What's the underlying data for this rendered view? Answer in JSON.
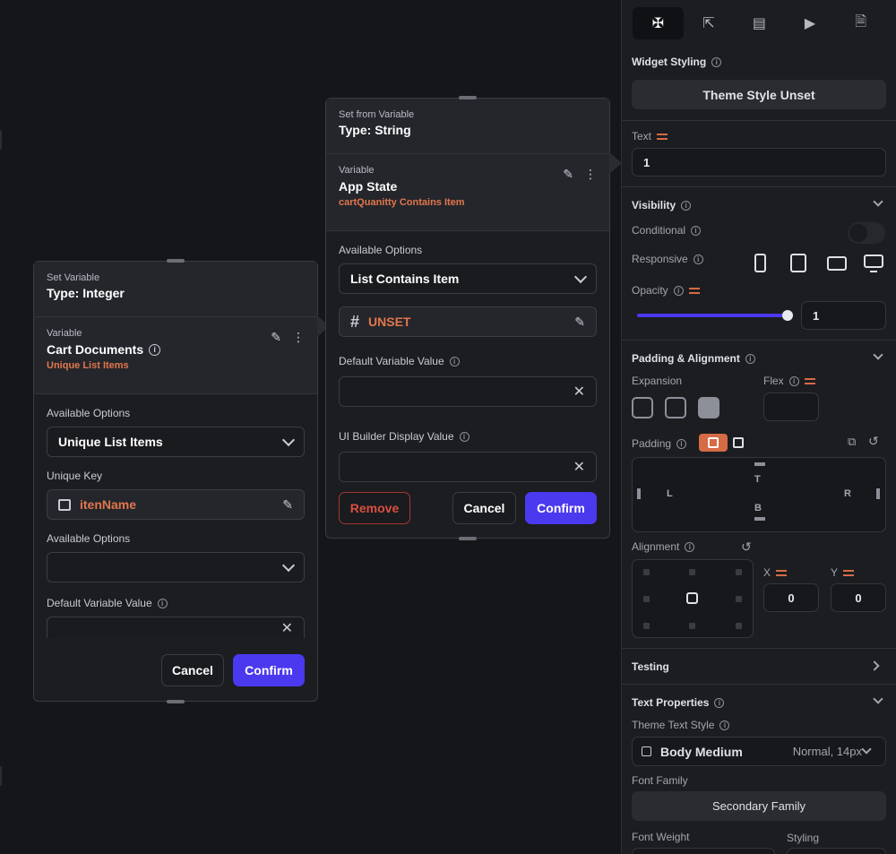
{
  "set_variable_panel": {
    "header_small": "Set Variable",
    "header_type": "Type: Integer",
    "variable_label": "Variable",
    "variable_name": "Cart Documents",
    "variable_sub": "Unique List Items",
    "available_options_label": "Available Options",
    "available_options_value": "Unique List Items",
    "unique_key_label": "Unique Key",
    "unique_key_value": "itenName",
    "available_options_label_2": "Available Options",
    "available_options_value_2": "",
    "default_value_label": "Default Variable Value",
    "cancel": "Cancel",
    "confirm": "Confirm"
  },
  "set_from_variable_panel": {
    "header_small": "Set from Variable",
    "header_type": "Type: String",
    "variable_label": "Variable",
    "variable_name": "App State",
    "variable_sub": "cartQuanitty Contains Item",
    "available_options_label": "Available Options",
    "available_options_value": "List Contains Item",
    "unset_value": "UNSET",
    "default_value_label": "Default Variable Value",
    "ui_builder_label": "UI Builder Display Value",
    "remove": "Remove",
    "cancel": "Cancel",
    "confirm": "Confirm"
  },
  "right_panel": {
    "widget_styling_label": "Widget Styling",
    "theme_style_button": "Theme Style Unset",
    "text_label": "Text",
    "text_value": "1",
    "visibility_label": "Visibility",
    "conditional_label": "Conditional",
    "responsive_label": "Responsive",
    "opacity_label": "Opacity",
    "opacity_value": "1",
    "opacity_fraction": 1,
    "padding_alignment_label": "Padding & Alignment",
    "expansion_label": "Expansion",
    "flex_label": "Flex",
    "padding_label": "Padding",
    "padding_t": "T",
    "padding_b": "B",
    "padding_l": "L",
    "padding_r": "R",
    "alignment_label": "Alignment",
    "x_label": "X",
    "y_label": "Y",
    "x_value": "0",
    "y_value": "0",
    "testing_label": "Testing",
    "text_properties_label": "Text Properties",
    "theme_text_style_label": "Theme Text Style",
    "theme_text_style_value": "Body Medium",
    "theme_text_style_meta": "Normal, 14px",
    "font_family_label": "Font Family",
    "font_family_value": "Secondary Family",
    "font_weight_label": "Font Weight",
    "styling_label": "Styling"
  },
  "colors": {
    "accent": "#4b39ef",
    "orange": "#e2764d",
    "remove_red": "#d94f3f"
  }
}
